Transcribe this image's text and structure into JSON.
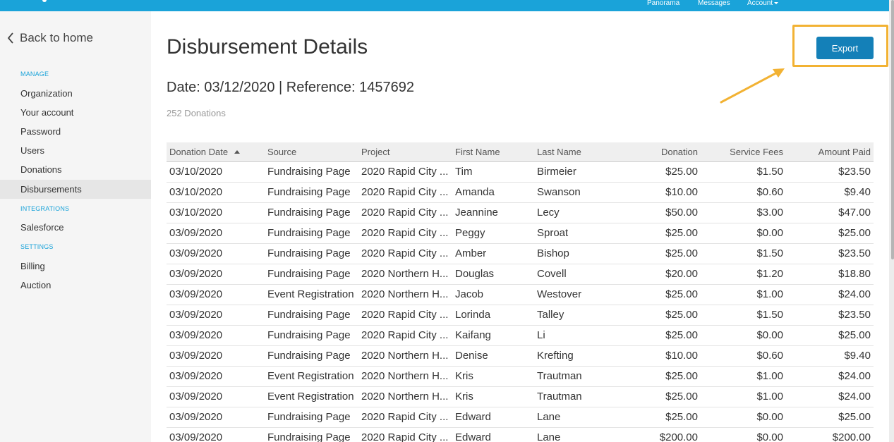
{
  "topbar": {
    "nav": [
      {
        "label": "Panorama"
      },
      {
        "label": "Messages"
      },
      {
        "label": "Account"
      }
    ]
  },
  "sidebar": {
    "back_label": "Back to home",
    "sections": [
      {
        "label": "MANAGE",
        "items": [
          {
            "label": "Organization"
          },
          {
            "label": "Your account"
          },
          {
            "label": "Password"
          },
          {
            "label": "Users"
          },
          {
            "label": "Donations"
          },
          {
            "label": "Disbursements",
            "active": true
          }
        ]
      },
      {
        "label": "INTEGRATIONS",
        "items": [
          {
            "label": "Salesforce"
          }
        ]
      },
      {
        "label": "SETTINGS",
        "items": [
          {
            "label": "Billing"
          },
          {
            "label": "Auction"
          }
        ]
      }
    ]
  },
  "main": {
    "title": "Disbursement Details",
    "subtitle": "Date: 03/12/2020 | Reference: 1457692",
    "count": "252 Donations",
    "export_label": "Export"
  },
  "colors": {
    "topbar": "#1aa3d9",
    "export_button": "#1480b8",
    "highlight": "#f2b233"
  },
  "table": {
    "columns": [
      "Donation Date",
      "Source",
      "Project",
      "First Name",
      "Last Name",
      "Donation",
      "Service Fees",
      "Amount Paid"
    ],
    "sorted_column": "Donation Date",
    "sort_direction": "ascending",
    "rows": [
      [
        "03/10/2020",
        "Fundraising Page",
        "2020 Rapid City ...",
        "Tim",
        "Birmeier",
        "$25.00",
        "$1.50",
        "$23.50"
      ],
      [
        "03/10/2020",
        "Fundraising Page",
        "2020 Rapid City ...",
        "Amanda",
        "Swanson",
        "$10.00",
        "$0.60",
        "$9.40"
      ],
      [
        "03/10/2020",
        "Fundraising Page",
        "2020 Rapid City ...",
        "Jeannine",
        "Lecy",
        "$50.00",
        "$3.00",
        "$47.00"
      ],
      [
        "03/09/2020",
        "Fundraising Page",
        "2020 Rapid City ...",
        "Peggy",
        "Sproat",
        "$25.00",
        "$0.00",
        "$25.00"
      ],
      [
        "03/09/2020",
        "Fundraising Page",
        "2020 Rapid City ...",
        "Amber",
        "Bishop",
        "$25.00",
        "$1.50",
        "$23.50"
      ],
      [
        "03/09/2020",
        "Fundraising Page",
        "2020 Northern H...",
        "Douglas",
        "Covell",
        "$20.00",
        "$1.20",
        "$18.80"
      ],
      [
        "03/09/2020",
        "Event Registration",
        "2020 Northern H...",
        "Jacob",
        "Westover",
        "$25.00",
        "$1.00",
        "$24.00"
      ],
      [
        "03/09/2020",
        "Fundraising Page",
        "2020 Rapid City ...",
        "Lorinda",
        "Talley",
        "$25.00",
        "$1.50",
        "$23.50"
      ],
      [
        "03/09/2020",
        "Fundraising Page",
        "2020 Rapid City ...",
        "Kaifang",
        "Li",
        "$25.00",
        "$0.00",
        "$25.00"
      ],
      [
        "03/09/2020",
        "Fundraising Page",
        "2020 Northern H...",
        "Denise",
        "Krefting",
        "$10.00",
        "$0.60",
        "$9.40"
      ],
      [
        "03/09/2020",
        "Event Registration",
        "2020 Northern H...",
        "Kris",
        "Trautman",
        "$25.00",
        "$1.00",
        "$24.00"
      ],
      [
        "03/09/2020",
        "Event Registration",
        "2020 Northern H...",
        "Kris",
        "Trautman",
        "$25.00",
        "$1.00",
        "$24.00"
      ],
      [
        "03/09/2020",
        "Fundraising Page",
        "2020 Rapid City ...",
        "Edward",
        "Lane",
        "$25.00",
        "$0.00",
        "$25.00"
      ],
      [
        "03/09/2020",
        "Fundraising Page",
        "2020 Rapid City ...",
        "Edward",
        "Lane",
        "$200.00",
        "$0.00",
        "$200.00"
      ]
    ]
  }
}
